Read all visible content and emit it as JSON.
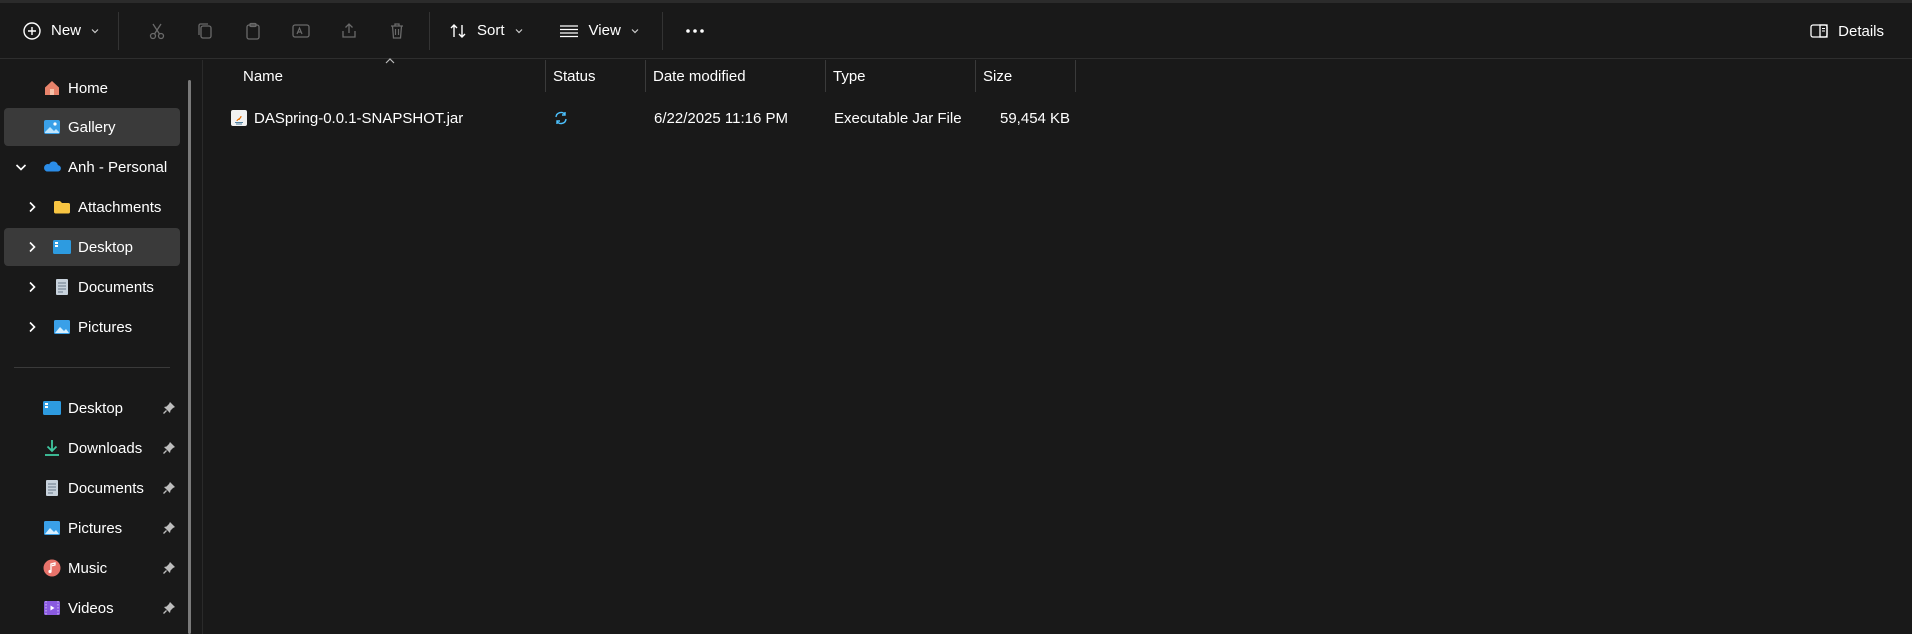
{
  "toolbar": {
    "new_label": "New",
    "sort_label": "Sort",
    "view_label": "View",
    "details_label": "Details"
  },
  "sidebar": {
    "home": "Home",
    "gallery": "Gallery",
    "onedrive": "Anh - Personal",
    "onedrive_children": [
      "Attachments",
      "Desktop",
      "Documents",
      "Pictures"
    ],
    "quick_access": [
      "Desktop",
      "Downloads",
      "Documents",
      "Pictures",
      "Music",
      "Videos"
    ]
  },
  "columns": {
    "name": "Name",
    "status": "Status",
    "date_modified": "Date modified",
    "type": "Type",
    "size": "Size"
  },
  "files": [
    {
      "name": "DASpring-0.0.1-SNAPSHOT.jar",
      "status_icon": "sync-icon",
      "date_modified": "6/22/2025 11:16 PM",
      "type": "Executable Jar File",
      "size": "59,454 KB"
    }
  ],
  "colors": {
    "background": "#191919",
    "selected": "#3a3a3a",
    "accent": "#4cc2ff",
    "folder": "#f8c542"
  }
}
